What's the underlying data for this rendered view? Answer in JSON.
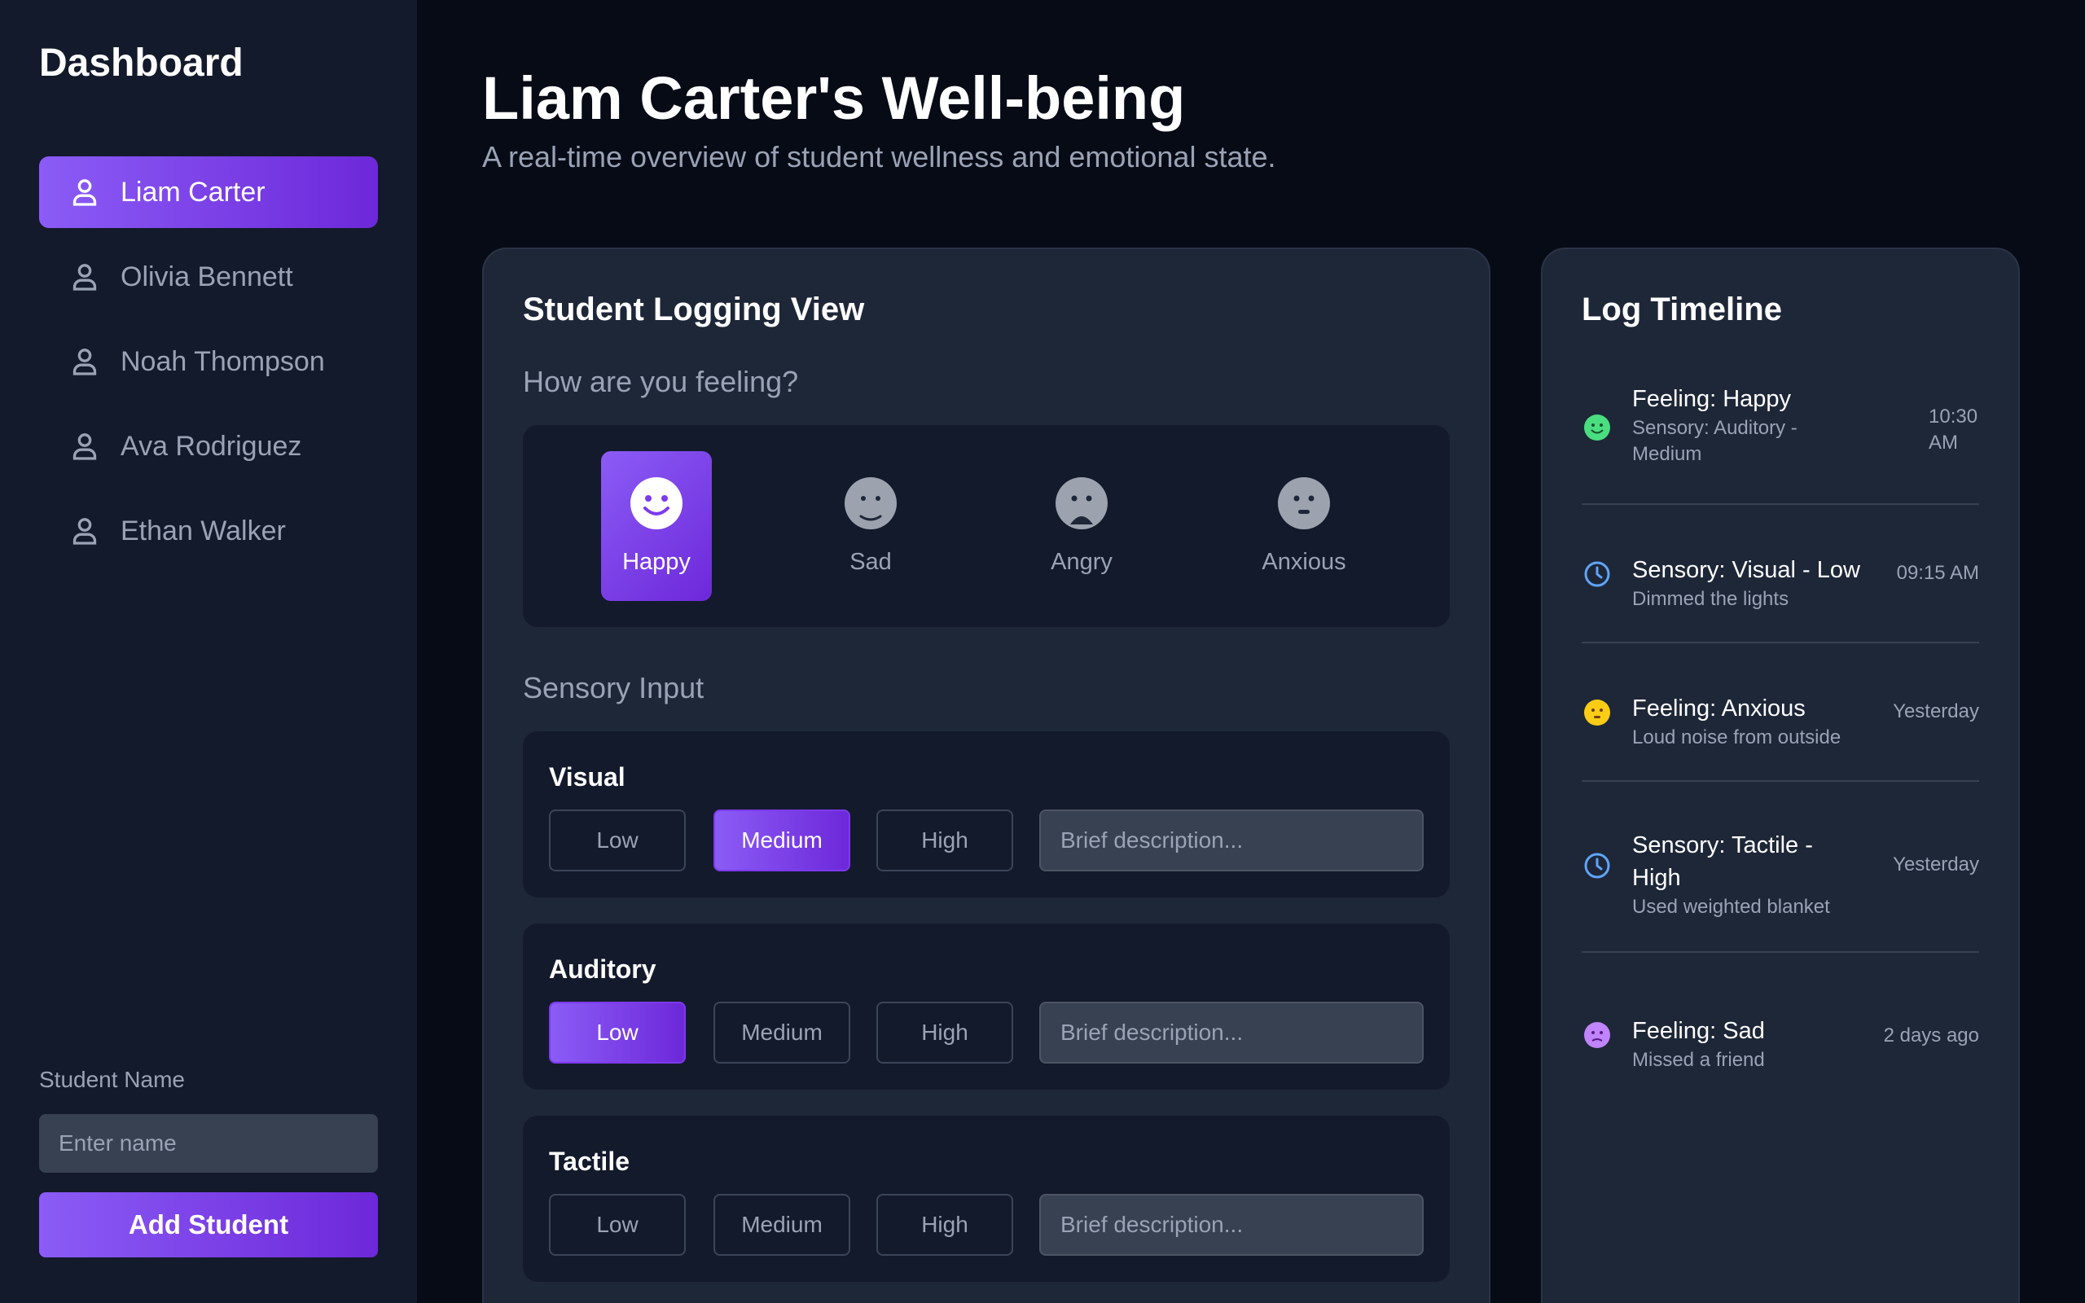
{
  "sidebar": {
    "title": "Dashboard",
    "students": [
      "Liam Carter",
      "Olivia Bennett",
      "Noah Thompson",
      "Ava Rodriguez",
      "Ethan Walker"
    ],
    "active_student": "Liam Carter",
    "add_label": "Student Name",
    "name_placeholder": "Enter name",
    "add_button": "Add Student"
  },
  "header": {
    "title": "Liam Carter's Well-being",
    "subtitle": "A real-time overview of student wellness and emotional state."
  },
  "logging": {
    "title": "Student Logging View",
    "feeling_prompt": "How are you feeling?",
    "moods": [
      "Happy",
      "Sad",
      "Angry",
      "Anxious"
    ],
    "selected_mood": "Happy",
    "sensory_title": "Sensory Input",
    "levels": [
      "Low",
      "Medium",
      "High"
    ],
    "description_placeholder": "Brief description...",
    "sensory": [
      {
        "name": "Visual",
        "selected": "Medium"
      },
      {
        "name": "Auditory",
        "selected": "Low"
      },
      {
        "name": "Tactile",
        "selected": ""
      }
    ]
  },
  "timeline": {
    "title": "Log Timeline",
    "entries": [
      {
        "icon": "happy-face-icon",
        "title": "Feeling: Happy",
        "desc": "Sensory: Auditory - Medium",
        "time": "10:30 AM",
        "color": "#4ade80"
      },
      {
        "icon": "clock-icon",
        "title": "Sensory: Visual - Low",
        "desc": "Dimmed the lights",
        "time": "09:15 AM",
        "color": "#60a5fa"
      },
      {
        "icon": "anxious-face-icon",
        "title": "Feeling: Anxious",
        "desc": "Loud noise from outside",
        "time": "Yesterday",
        "color": "#facc15"
      },
      {
        "icon": "clock-icon",
        "title": "Sensory: Tactile - High",
        "desc": "Used weighted blanket",
        "time": "Yesterday",
        "color": "#60a5fa"
      },
      {
        "icon": "sad-face-icon",
        "title": "Feeling: Sad",
        "desc": "Missed a friend",
        "time": "2 days ago",
        "color": "#c084fc"
      }
    ]
  },
  "colors": {
    "accent": "#8b5cf6",
    "accent_dark": "#6d28d9",
    "background": "#070b16",
    "panel": "#1e2738",
    "muted_text": "#9aa3b5"
  }
}
